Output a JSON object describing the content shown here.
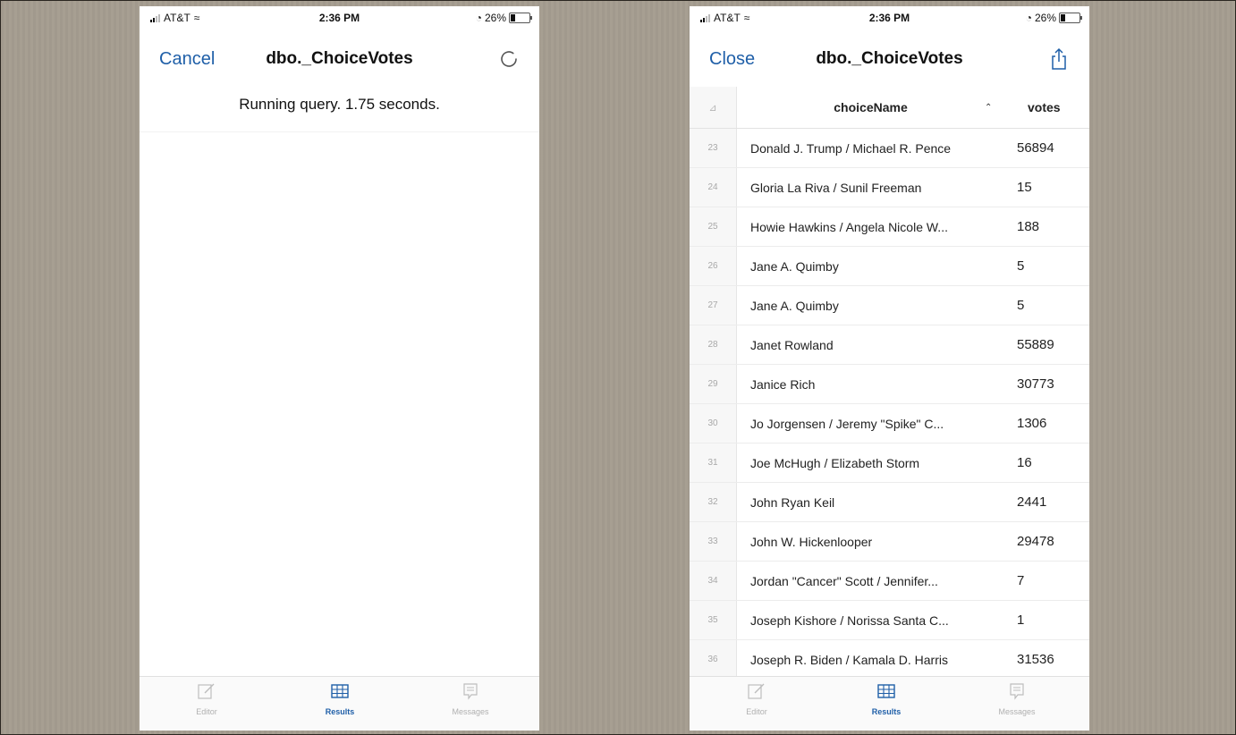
{
  "left_phone": {
    "status_bar": {
      "carrier": "AT&T",
      "time": "2:36 PM",
      "battery": "26%",
      "battery_level": 0.26
    },
    "nav": {
      "left_button": "Cancel",
      "title": "dbo._ChoiceVotes",
      "right_icon": "spinner-icon"
    },
    "query_status": "Running query. 1.75 seconds.",
    "tabs": [
      {
        "label": "Editor",
        "icon": "editor-icon",
        "active": false
      },
      {
        "label": "Results",
        "icon": "grid-icon",
        "active": true
      },
      {
        "label": "Messages",
        "icon": "messages-icon",
        "active": false
      }
    ]
  },
  "right_phone": {
    "status_bar": {
      "carrier": "AT&T",
      "time": "2:36 PM",
      "battery": "26%",
      "battery_level": 0.26
    },
    "nav": {
      "left_button": "Close",
      "title": "dbo._ChoiceVotes",
      "right_icon": "share-icon"
    },
    "table": {
      "columns": [
        "choiceName",
        "votes"
      ],
      "rows": [
        {
          "num": "23",
          "name": "Donald J. Trump / Michael R. Pence",
          "votes": "56894"
        },
        {
          "num": "24",
          "name": "Gloria La Riva / Sunil Freeman",
          "votes": "15"
        },
        {
          "num": "25",
          "name": "Howie Hawkins / Angela Nicole W...",
          "votes": "188"
        },
        {
          "num": "26",
          "name": "Jane A. Quimby",
          "votes": "5"
        },
        {
          "num": "27",
          "name": "Jane A. Quimby",
          "votes": "5"
        },
        {
          "num": "28",
          "name": "Janet Rowland",
          "votes": "55889"
        },
        {
          "num": "29",
          "name": "Janice Rich",
          "votes": "30773"
        },
        {
          "num": "30",
          "name": "Jo Jorgensen / Jeremy \"Spike\" C...",
          "votes": "1306"
        },
        {
          "num": "31",
          "name": "Joe McHugh / Elizabeth Storm",
          "votes": "16"
        },
        {
          "num": "32",
          "name": "John Ryan Keil",
          "votes": "2441"
        },
        {
          "num": "33",
          "name": "John W. Hickenlooper",
          "votes": "29478"
        },
        {
          "num": "34",
          "name": "Jordan \"Cancer\" Scott / Jennifer...",
          "votes": "7"
        },
        {
          "num": "35",
          "name": "Joseph Kishore / Norissa Santa C...",
          "votes": "1"
        },
        {
          "num": "36",
          "name": "Joseph R. Biden / Kamala D. Harris",
          "votes": "31536"
        }
      ]
    },
    "tabs": [
      {
        "label": "Editor",
        "icon": "editor-icon",
        "active": false
      },
      {
        "label": "Results",
        "icon": "grid-icon",
        "active": true
      },
      {
        "label": "Messages",
        "icon": "messages-icon",
        "active": false
      }
    ]
  },
  "colors": {
    "accent": "#1f5fa8",
    "backdrop": "#a59d90"
  }
}
